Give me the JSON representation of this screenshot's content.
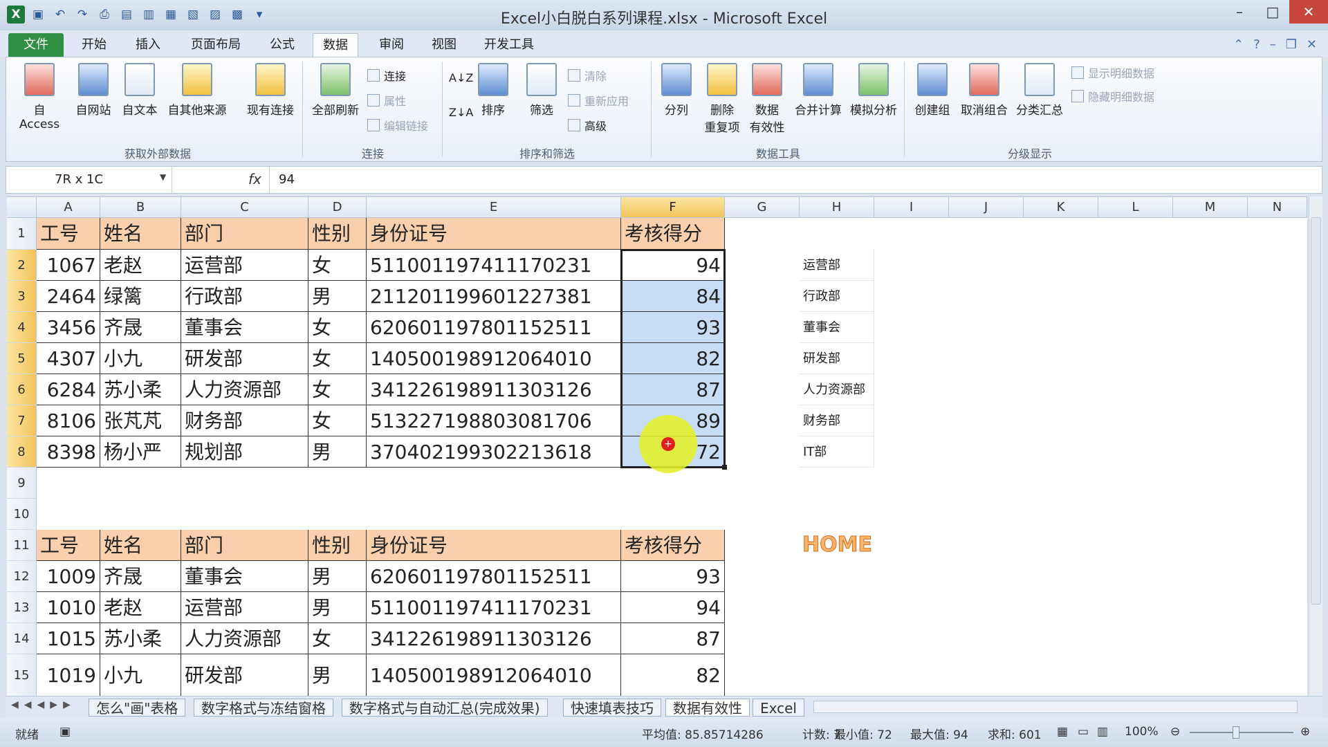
{
  "window": {
    "title": "Excel小白脱白系列课程.xlsx - Microsoft Excel"
  },
  "tabs": [
    "文件",
    "开始",
    "插入",
    "页面布局",
    "公式",
    "数据",
    "审阅",
    "视图",
    "开发工具"
  ],
  "ribbon": {
    "external": {
      "access": "自 Access",
      "web": "自网站",
      "text": "自文本",
      "other": "自其他来源",
      "existing": "现有连接",
      "group": "获取外部数据"
    },
    "connections": {
      "refresh_all": "全部刷新",
      "connections": "连接",
      "properties": "属性",
      "edit_links": "编辑链接",
      "group": "连接"
    },
    "sort_filter": {
      "sort": "排序",
      "filter": "筛选",
      "clear": "清除",
      "reapply": "重新应用",
      "advanced": "高级",
      "group": "排序和筛选"
    },
    "data_tools": {
      "text_to_columns": "分列",
      "remove_dup_1": "删除",
      "remove_dup_2": "重复项",
      "validation_1": "数据",
      "validation_2": "有效性",
      "consolidate": "合并计算",
      "what_if": "模拟分析",
      "group": "数据工具"
    },
    "outline": {
      "group_btn": "创建组",
      "ungroup": "取消组合",
      "subtotal": "分类汇总",
      "show_detail": "显示明细数据",
      "hide_detail": "隐藏明细数据",
      "group": "分级显示"
    }
  },
  "formula_bar": {
    "name_box": "7R x 1C",
    "fx": "fx",
    "value": "94"
  },
  "columns": [
    "A",
    "B",
    "C",
    "D",
    "E",
    "F",
    "G",
    "H",
    "I",
    "J",
    "K",
    "L",
    "M",
    "N"
  ],
  "rows": [
    "1",
    "2",
    "3",
    "4",
    "5",
    "6",
    "7",
    "8",
    "9",
    "10",
    "11",
    "12",
    "13",
    "14",
    "15"
  ],
  "table1": {
    "headers": [
      "工号",
      "姓名",
      "部门",
      "性别",
      "身份证号",
      "考核得分"
    ],
    "rows": [
      [
        "1067",
        "老赵",
        "运营部",
        "女",
        "511001197411170231",
        "94"
      ],
      [
        "2464",
        "绿篱",
        "行政部",
        "男",
        "211201199601227381",
        "84"
      ],
      [
        "3456",
        "齐晟",
        "董事会",
        "女",
        "620601197801152511",
        "93"
      ],
      [
        "4307",
        "小九",
        "研发部",
        "女",
        "140500198912064010",
        "82"
      ],
      [
        "6284",
        "苏小柔",
        "人力资源部",
        "女",
        "341226198911303126",
        "87"
      ],
      [
        "8106",
        "张芃芃",
        "财务部",
        "女",
        "513227198803081706",
        "89"
      ],
      [
        "8398",
        "杨小严",
        "规划部",
        "男",
        "370402199302213618",
        "72"
      ]
    ]
  },
  "dept_list": [
    "运营部",
    "行政部",
    "董事会",
    "研发部",
    "人力资源部",
    "财务部",
    "IT部"
  ],
  "logo_text": "HOME",
  "table2": {
    "headers": [
      "工号",
      "姓名",
      "部门",
      "性别",
      "身份证号",
      "考核得分"
    ],
    "rows": [
      [
        "1009",
        "齐晟",
        "董事会",
        "男",
        "620601197801152511",
        "93"
      ],
      [
        "1010",
        "老赵",
        "运营部",
        "男",
        "511001197411170231",
        "94"
      ],
      [
        "1015",
        "苏小柔",
        "人力资源部",
        "女",
        "341226198911303126",
        "87"
      ],
      [
        "1019",
        "小九",
        "研发部",
        "男",
        "140500198912064010",
        "82"
      ]
    ]
  },
  "sheets": [
    "怎么\"画\"表格",
    "数字格式与冻结窗格",
    "数字格式与自动汇总(完成效果)",
    "快速填表技巧",
    "数据有效性",
    "Excel"
  ],
  "status": {
    "ready": "就绪",
    "average": "平均值: 85.85714286",
    "count": "计数: 7",
    "min": "最小值: 72",
    "max": "最大值: 94",
    "sum": "求和: 601",
    "zoom": "100%"
  }
}
